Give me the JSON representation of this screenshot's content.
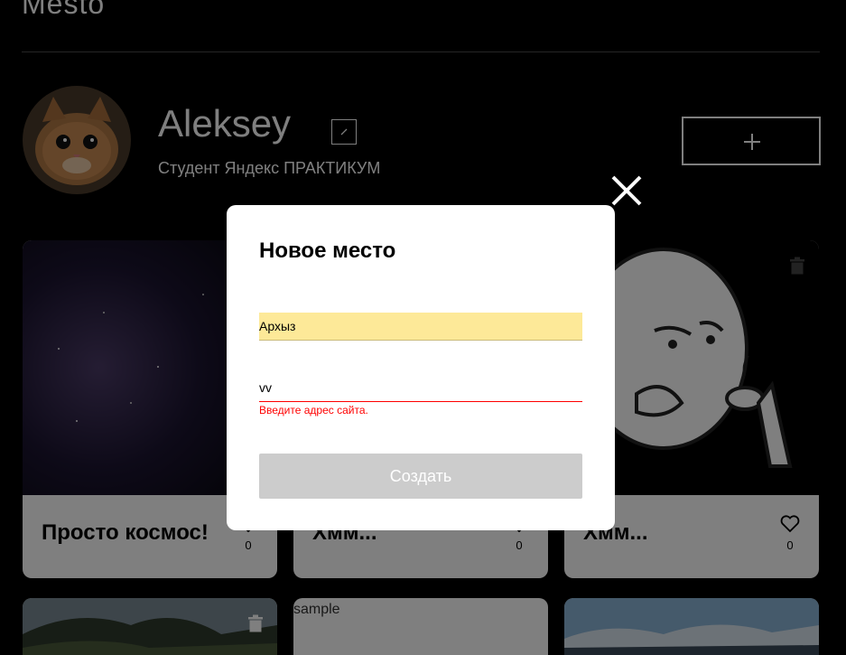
{
  "header": {
    "logo": "Mesto"
  },
  "profile": {
    "name": "Aleksey",
    "about": "Студент Яндекс ПРАКТИКУМ",
    "edit_icon": "pencil-icon",
    "add_icon": "plus-icon"
  },
  "cards": [
    {
      "title": "Просто космос!",
      "likes": "0",
      "has_trash": false
    },
    {
      "title": "Хмм...",
      "likes": "0",
      "has_trash": false
    },
    {
      "title": "Хмм...",
      "likes": "0",
      "has_trash": true
    }
  ],
  "bottom_cards": [
    {
      "alt": "",
      "has_trash": true
    },
    {
      "alt": "sample",
      "has_trash": false
    },
    {
      "alt": "",
      "has_trash": false
    }
  ],
  "modal": {
    "title": "Новое место",
    "name_value": "Архыз",
    "link_value": "vv",
    "link_error": "Введите адрес сайта.",
    "submit_label": "Создать",
    "close_icon": "close-icon"
  },
  "colors": {
    "autofill_yellow": "#fde998",
    "error_red": "#ff0000",
    "disabled_button": "#cccccc"
  }
}
